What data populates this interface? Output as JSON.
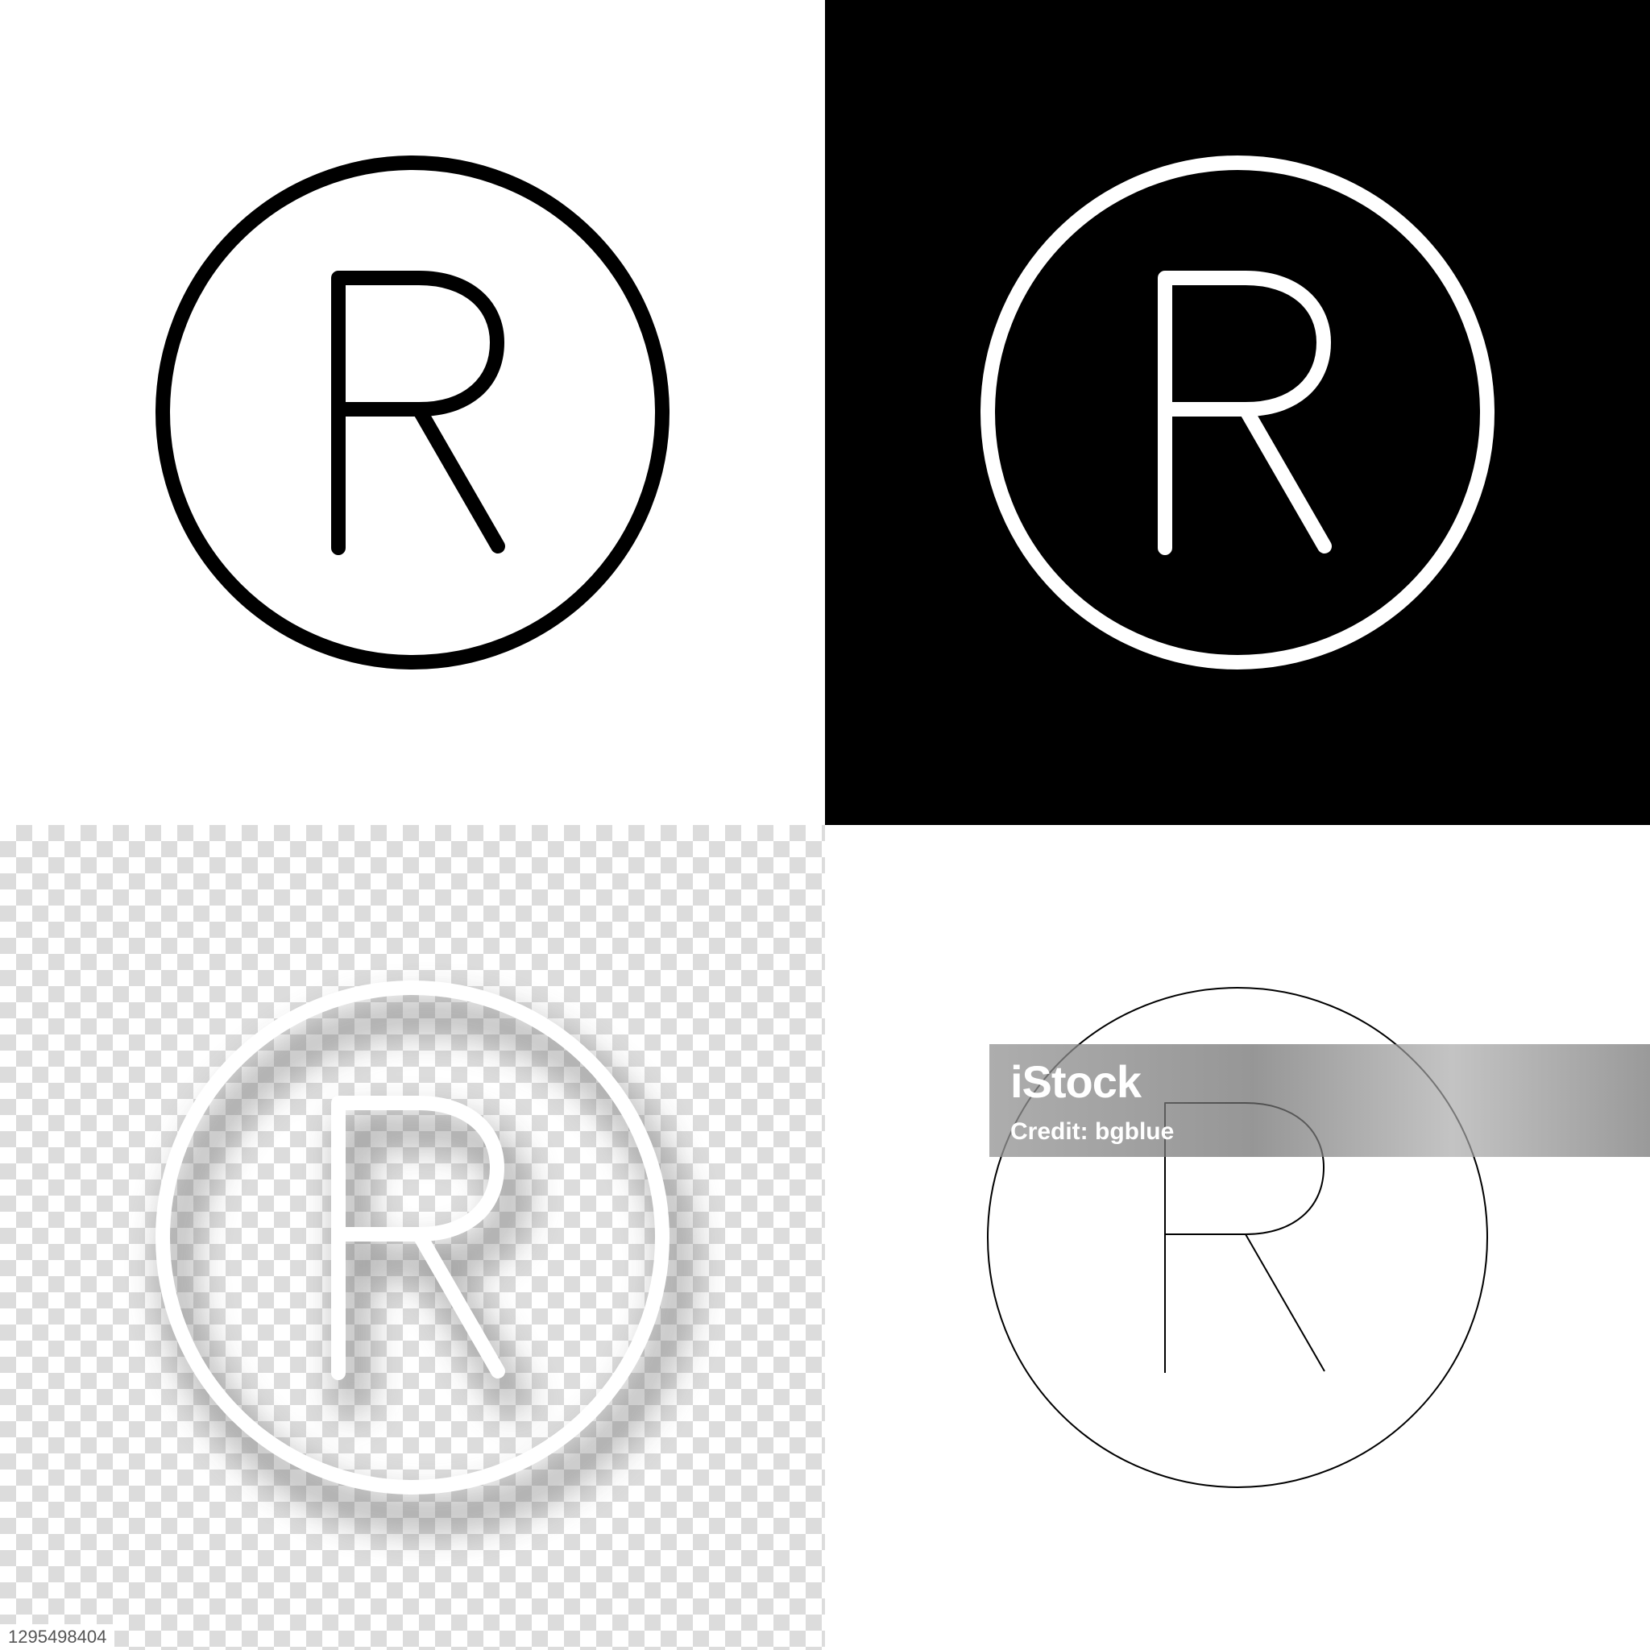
{
  "panels": [
    {
      "id": "black-on-white",
      "background": "#ffffff",
      "stroke": "#000000",
      "glyph": "R"
    },
    {
      "id": "white-on-black",
      "background": "#000000",
      "stroke": "#ffffff",
      "glyph": "R"
    },
    {
      "id": "white-on-transparent",
      "background": "checkerboard",
      "stroke": "#ffffff",
      "glyph": "R"
    },
    {
      "id": "outline-thin",
      "background": "#ffffff",
      "stroke": "#000000",
      "glyph": "R"
    }
  ],
  "watermark": {
    "logo": "iStock",
    "credit": "Credit: bgblue"
  },
  "image_id": "1295498404",
  "icon": "registered-trademark-icon"
}
